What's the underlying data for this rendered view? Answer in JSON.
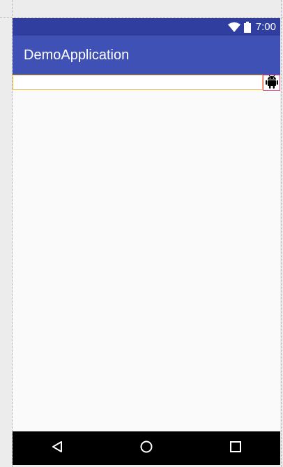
{
  "status_bar": {
    "time": "7:00",
    "background": "#303f9f",
    "icons": [
      "wifi-icon",
      "battery-icon"
    ]
  },
  "app_bar": {
    "title": "DemoApplication",
    "background": "#3f51b5"
  },
  "content": {
    "text_field": {
      "value": "",
      "placeholder": "",
      "border_color": "#f4b942"
    },
    "image_button": {
      "icon": "android-icon",
      "border_color": "#e04a8a"
    }
  },
  "nav_bar": {
    "background": "#000000",
    "buttons": [
      "back-icon",
      "home-icon",
      "recents-icon"
    ]
  }
}
